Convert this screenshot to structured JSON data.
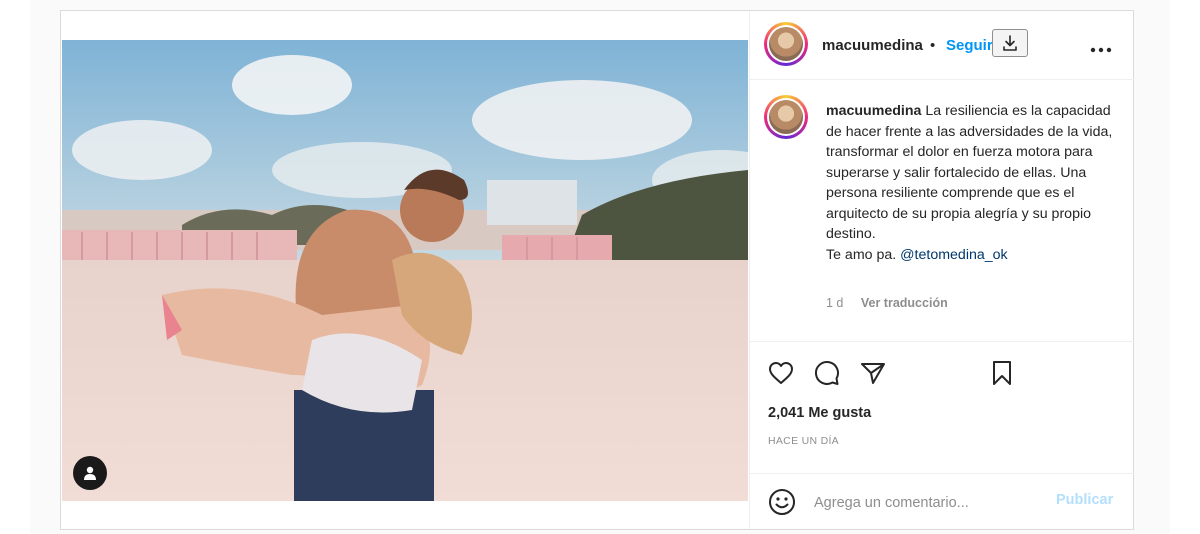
{
  "post": {
    "username": "macuumedina",
    "separator": "•",
    "follow_label": "Seguir",
    "download_icon": "download-icon",
    "more_icon": "more-options-icon",
    "photo_user_icon": "tagged-user-icon"
  },
  "caption": {
    "username": "macuumedina",
    "text": "La resiliencia es la capacidad de hacer frente a las adversidades de la vida, transformar el dolor en fuerza motora para superarse y salir fortalecido de ellas. Una persona resiliente comprende que es el arquitecto de su propia alegría y su propio destino.",
    "line_final": "Te amo pa.",
    "mention": "@tetomedina_ok",
    "age": "1 d",
    "translate_label": "Ver traducción"
  },
  "actions": {
    "like_icon": "heart-icon",
    "comment_icon": "comment-icon",
    "share_icon": "share-icon",
    "save_icon": "bookmark-icon",
    "likes": "2,041 Me gusta",
    "timestamp": "HACE UN DÍA"
  },
  "comment": {
    "emoji_icon": "emoji-icon",
    "placeholder": "Agrega un comentario...",
    "publish_label": "Publicar"
  },
  "colors": {
    "accent": "#0095f6",
    "publish_disabled": "#b2dffc",
    "mention": "#00376b",
    "muted": "#8e8e8e"
  }
}
